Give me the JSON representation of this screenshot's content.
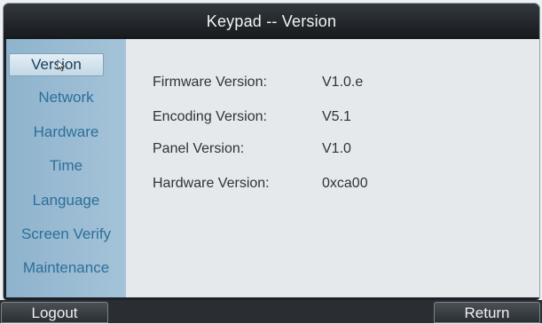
{
  "window": {
    "title": "Keypad -- Version"
  },
  "sidebar": {
    "items": [
      {
        "label": "Version",
        "active": true
      },
      {
        "label": "Network",
        "active": false
      },
      {
        "label": "Hardware",
        "active": false
      },
      {
        "label": "Time",
        "active": false
      },
      {
        "label": "Language",
        "active": false
      },
      {
        "label": "Screen Verify",
        "active": false
      },
      {
        "label": "Maintenance",
        "active": false
      }
    ]
  },
  "info": {
    "rows": [
      {
        "label": "Firmware Version:",
        "value": "V1.0.e"
      },
      {
        "label": "Encoding Version:",
        "value": "V5.1"
      },
      {
        "label": "Panel Version:",
        "value": "V1.0"
      },
      {
        "label": "Hardware Version:",
        "value": "0xca00"
      }
    ]
  },
  "footer": {
    "logout_label": "Logout",
    "return_label": "Return"
  },
  "colors": {
    "sidebar_bg": "#9bbdd4",
    "sidebar_text": "#2c6f9a",
    "content_bg": "#e6e9ec",
    "titlebar_bg": "#22272b"
  },
  "icons": {
    "cursor": "mouse-pointer-icon"
  }
}
